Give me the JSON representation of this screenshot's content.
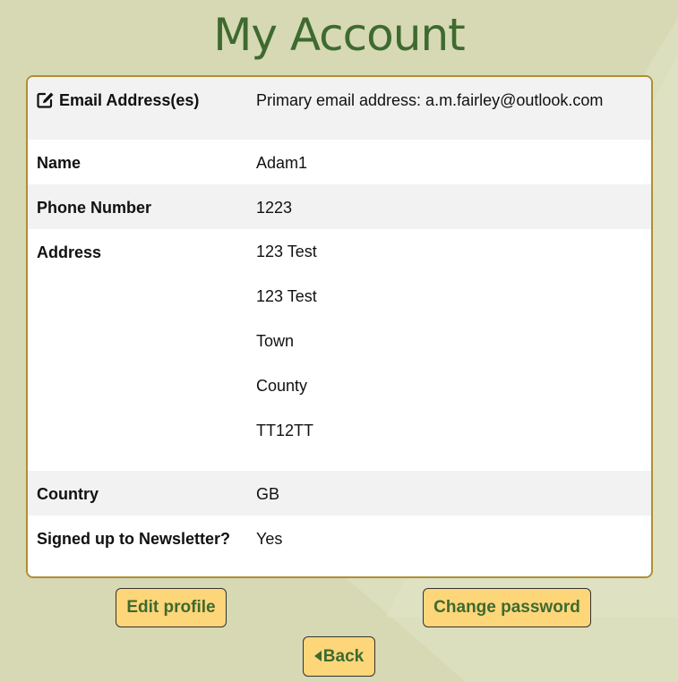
{
  "page": {
    "title": "My Account"
  },
  "account": {
    "email": {
      "label": "Email Address(es)",
      "value": "Primary email address: a.m.fairley@outlook.com"
    },
    "name": {
      "label": "Name",
      "value": "Adam1"
    },
    "phone": {
      "label": "Phone Number",
      "value": "1223"
    },
    "address": {
      "label": "Address",
      "lines": [
        "123 Test",
        "123 Test",
        "Town",
        "County",
        "TT12TT"
      ]
    },
    "country": {
      "label": "Country",
      "value": "GB"
    },
    "newsletter": {
      "label": "Signed up to Newsletter?",
      "value": "Yes"
    }
  },
  "actions": {
    "edit_profile": "Edit profile",
    "change_password": "Change password",
    "back": "Back"
  },
  "colors": {
    "background": "#d6d9b3",
    "title_green": "#3e6a30",
    "card_border": "#b08f33",
    "button_fill": "#fdd67a",
    "row_shade": "#f2f2f2"
  },
  "icons": {
    "email_label_icon": "edit-icon",
    "back_button_icon": "caret-left-icon"
  }
}
